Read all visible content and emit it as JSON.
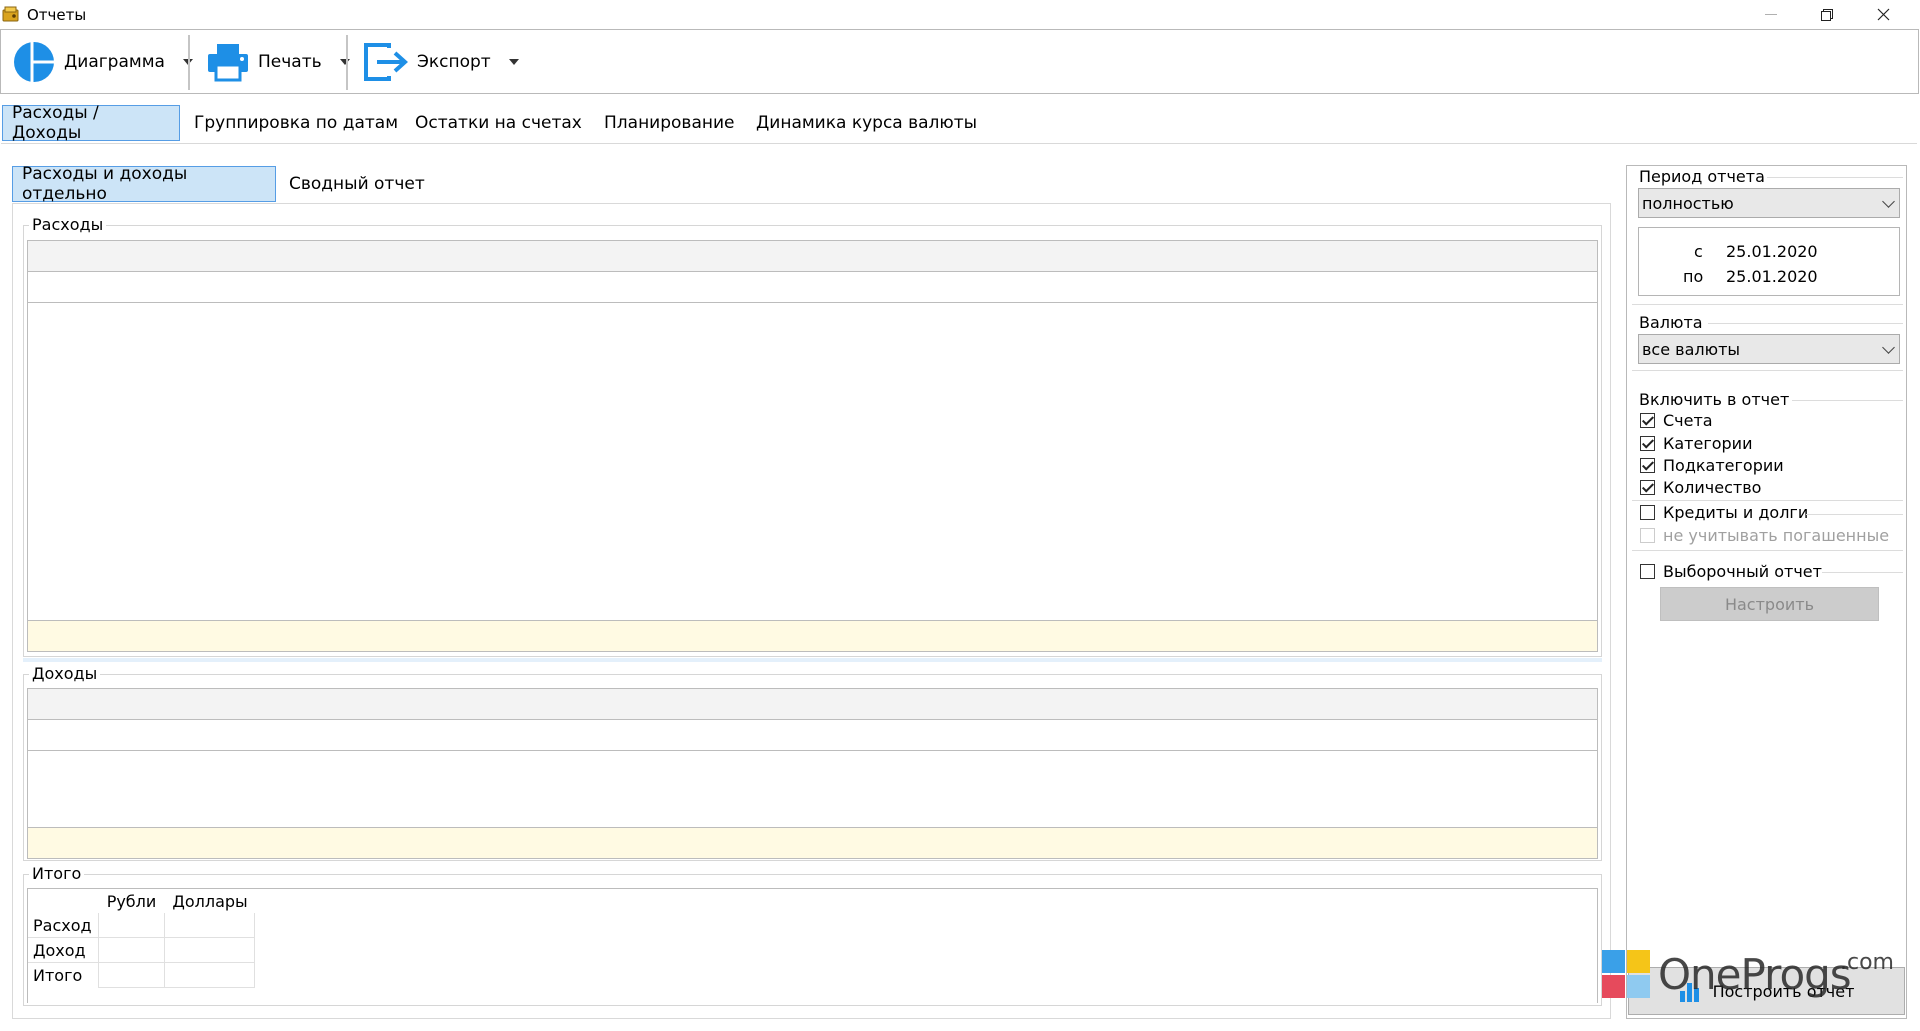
{
  "window": {
    "title": "Отчеты",
    "minimize_icon": "minimize-icon",
    "maximize_icon": "restore-icon",
    "close_icon": "close-icon"
  },
  "toolbar": {
    "chart_label": "Диаграмма",
    "print_label": "Печать",
    "export_label": "Экспорт"
  },
  "main_tabs": [
    {
      "label": "Расходы / Доходы",
      "active": true
    },
    {
      "label": "Группировка по датам"
    },
    {
      "label": "Остатки на счетах"
    },
    {
      "label": "Планирование"
    },
    {
      "label": "Динамика курса валюты"
    }
  ],
  "sub_tabs": [
    {
      "label": "Расходы и доходы отдельно",
      "active": true
    },
    {
      "label": "Сводный отчет"
    }
  ],
  "groups": {
    "expenses": "Расходы",
    "income": "Доходы",
    "totals": "Итого"
  },
  "summary": {
    "columns": [
      "Рубли",
      "Доллары"
    ],
    "rows": [
      "Расход",
      "Доход",
      "Итого"
    ]
  },
  "right_panel": {
    "period_label": "Период отчета",
    "period_value": "полностью",
    "from_label": "с",
    "from_date": "25.01.2020",
    "to_label": "по",
    "to_date": "25.01.2020",
    "currency_label": "Валюта",
    "currency_value": "все валюты",
    "include_label": "Включить в отчет",
    "checkboxes": [
      {
        "label": "Счета",
        "checked": true
      },
      {
        "label": "Категории",
        "checked": true
      },
      {
        "label": "Подкатегории",
        "checked": true
      },
      {
        "label": "Количество",
        "checked": true
      },
      {
        "label": "Кредиты и долги",
        "checked": false
      },
      {
        "label": "не учитывать погашенные",
        "checked": false,
        "disabled": true
      }
    ],
    "custom_report_label": "Выборочный отчет",
    "configure_label": "Настроить",
    "build_label": "Построить отчет"
  },
  "watermark": {
    "brand": "OneProgs",
    "suffix": ".com"
  },
  "colors": {
    "active_tab_bg": "#cce4f7",
    "active_tab_border": "#569de5",
    "total_row_bg": "#fffae3",
    "icon_blue": "#1e8fe6"
  }
}
